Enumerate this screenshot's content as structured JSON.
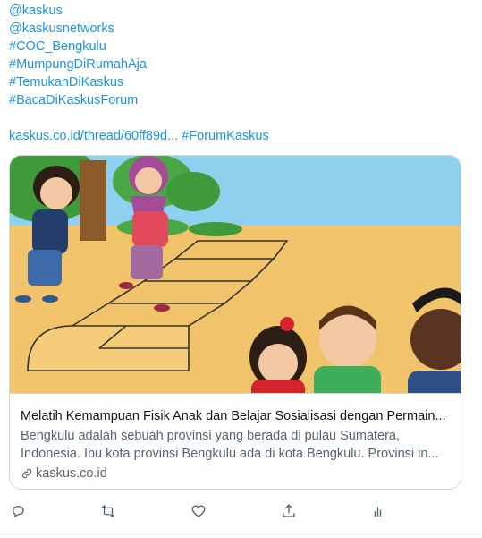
{
  "tweet": {
    "lines": [
      "@kaskus",
      "@kaskusnetworks",
      "#COC_Bengkulu",
      "#MumpungDiRumahAja",
      "#TemukanDiKaskus",
      "#BacaDiKaskusForum"
    ],
    "url_text": "kaskus.co.id/thread/60ff89d...",
    "url_hashtag": "#ForumKaskus"
  },
  "card": {
    "title": "Melatih Kemampuan Fisik Anak dan Belajar Sosialisasi dengan Permain...",
    "description": "Bengkulu adalah sebuah provinsi yang berada di pulau Sumatera, Indonesia. Ibu kota provinsi Bengkulu ada di kota Bengkulu. Provinsi in...",
    "domain": "kaskus.co.id",
    "image_icon": "children-playing-hopscotch-illustration"
  },
  "colors": {
    "link": "#1b95e0",
    "icon": "#536471",
    "border": "#cfd9de"
  },
  "actions": {
    "reply_icon": "reply-icon",
    "retweet_icon": "retweet-icon",
    "like_icon": "heart-icon",
    "share_icon": "share-icon",
    "analytics_icon": "analytics-icon"
  }
}
